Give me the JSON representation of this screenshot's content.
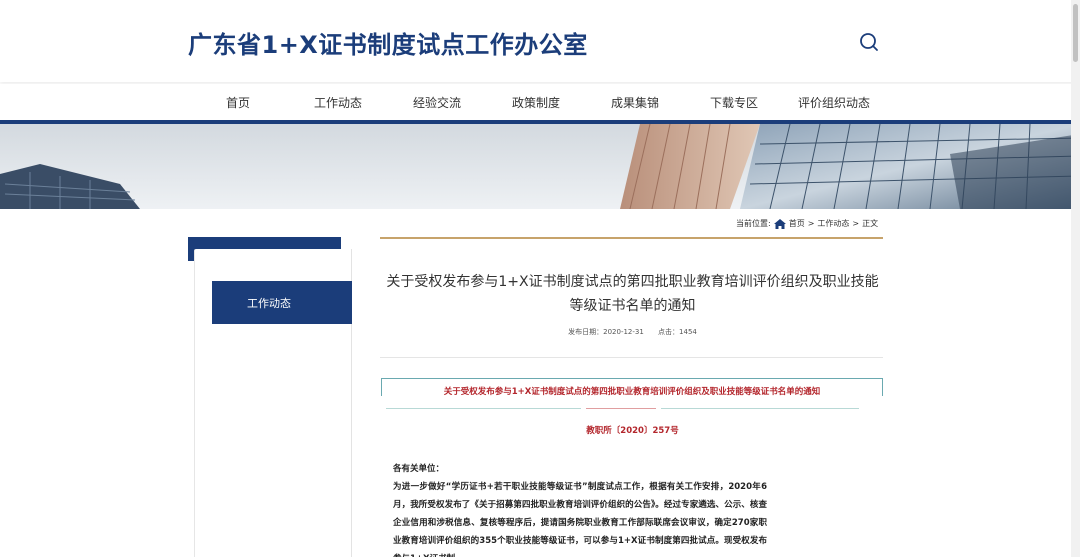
{
  "header": {
    "site_title": "广东省1+X证书制度试点工作办公室"
  },
  "icons": {
    "search": "search-icon",
    "home": "home-icon"
  },
  "nav": {
    "items": [
      {
        "label": "首页"
      },
      {
        "label": "工作动态"
      },
      {
        "label": "经验交流"
      },
      {
        "label": "政策制度"
      },
      {
        "label": "成果集锦"
      },
      {
        "label": "下载专区"
      },
      {
        "label": "评价组织动态"
      }
    ]
  },
  "breadcrumb": {
    "prefix": "当前位置:",
    "home": "首页",
    "sep1": ">",
    "section": "工作动态",
    "sep2": ">",
    "current": "正文"
  },
  "sidebar": {
    "items": [
      {
        "label": "工作动态"
      }
    ]
  },
  "article": {
    "title": "关于受权发布参与1+X证书制度试点的第四批职业教育培训评价组织及职业技能等级证书名单的通知",
    "publish_date": "发布日期：2020-12-31",
    "clicks": "点击：1454",
    "doc_title": "关于受权发布参与1+X证书制度试点的第四批职业教育培训评价组织及职业技能等级证书名单的通知",
    "doc_number": "教职所〔2020〕257号",
    "salutation": "各有关单位：",
    "body": "为进一步做好“学历证书+若干职业技能等级证书”制度试点工作，根据有关工作安排，2020年6月，我所受权发布了《关于招募第四批职业教育培训评价组织的公告》。经过专家遴选、公示、核查企业信用和涉税信息、复核等程序后，提请国务院职业教育工作部际联席会议审议，确定270家职业教育培训评价组织的355个职业技能等级证书，可以参与1+X证书制度第四批试点。现受权发布参与1+X证书制"
  },
  "colors": {
    "brand_blue": "#1b3d7a",
    "accent_gold": "#c7a36b",
    "doc_red": "#b3262c",
    "doc_teal": "#6aa9b0"
  }
}
